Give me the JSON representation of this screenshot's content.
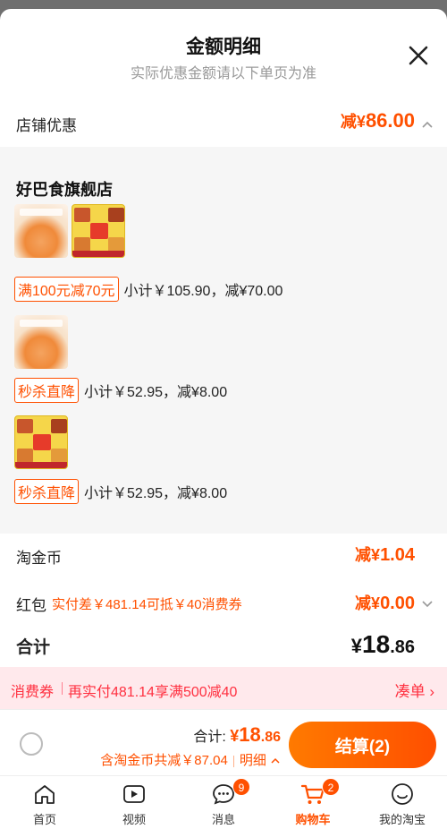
{
  "header": {
    "title": "金额明细",
    "subtitle": "实际优惠金额请以下单页为准"
  },
  "store_discount": {
    "label": "店铺优惠",
    "prefix": "减¥",
    "amount": "86.00"
  },
  "shop": {
    "name": "好巴食旗舰店",
    "groups": [
      {
        "tag": "满100元减70元",
        "text": "小计￥105.90，减¥70.00"
      },
      {
        "tag": "秒杀直降",
        "text": "小计￥52.95，减¥8.00"
      },
      {
        "tag": "秒杀直降",
        "text": "小计￥52.95，减¥8.00"
      }
    ]
  },
  "taojinbi": {
    "label": "淘金币",
    "prefix": "减¥",
    "amount": "1.04"
  },
  "hongbao": {
    "label": "红包",
    "note": "实付差￥481.14可抵￥40消费券",
    "prefix": "减¥",
    "amount": "0.00"
  },
  "total": {
    "label": "合计",
    "currency": "¥",
    "integer": "18",
    "decimal": ".86"
  },
  "coupon_banner": {
    "tag": "消费券",
    "message": "再实付481.14享满500减40",
    "link": "凑单 ›"
  },
  "checkout": {
    "total_label": "合计:",
    "total_currency": "¥",
    "total_integer": "18",
    "total_decimal": ".86",
    "detail_text": "含淘金币共减￥87.04",
    "detail_link": "明细",
    "button": "结算(2)"
  },
  "tabbar": {
    "items": [
      {
        "label": "首页",
        "icon": "home-icon"
      },
      {
        "label": "视频",
        "icon": "video-icon"
      },
      {
        "label": "消息",
        "icon": "message-icon",
        "badge": "9"
      },
      {
        "label": "购物车",
        "icon": "cart-icon",
        "badge": "2",
        "active": true
      },
      {
        "label": "我的淘宝",
        "icon": "profile-icon"
      }
    ]
  },
  "colors": {
    "accent": "#ff5000",
    "coupon": "#ff3040",
    "coupon_bg": "#ffe9ec"
  }
}
